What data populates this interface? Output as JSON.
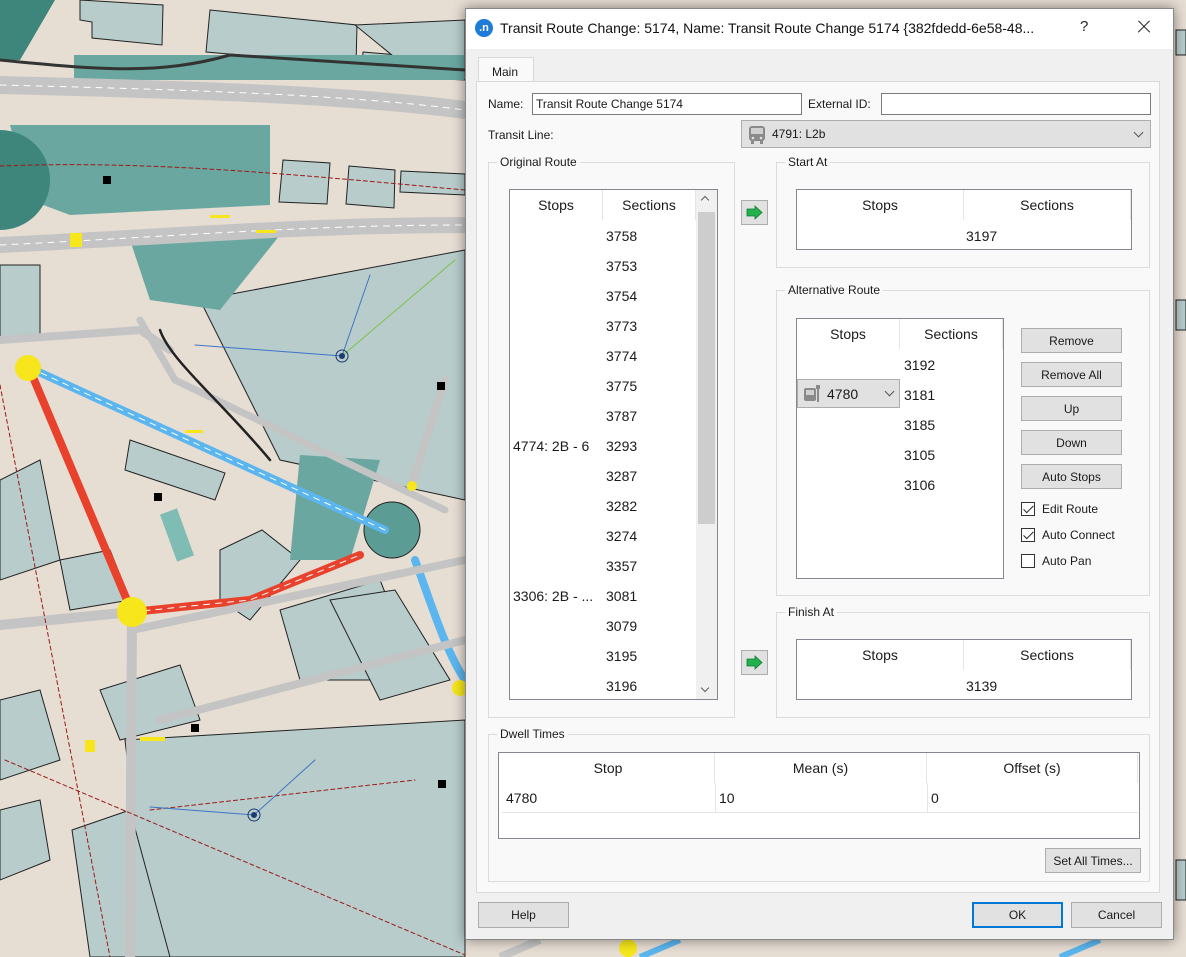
{
  "window": {
    "title": "Transit Route Change: 5174, Name: Transit Route Change 5174  {382fdedd-6e58-48...",
    "help_glyph": "?",
    "app_icon_glyph": ".n"
  },
  "tabs": [
    {
      "label": "Main",
      "active": true
    }
  ],
  "form": {
    "name_label": "Name:",
    "name_value": "Transit Route Change 5174",
    "external_id_label": "External ID:",
    "external_id_value": "",
    "transit_line_label": "Transit Line:",
    "transit_line_value": "4791: L2b",
    "transit_line_icon": "bus-icon"
  },
  "original_route": {
    "title": "Original Route",
    "columns": [
      "Stops",
      "Sections"
    ],
    "rows": [
      {
        "stop": "",
        "section": "3758"
      },
      {
        "stop": "",
        "section": "3753"
      },
      {
        "stop": "",
        "section": "3754"
      },
      {
        "stop": "",
        "section": "3773"
      },
      {
        "stop": "",
        "section": "3774"
      },
      {
        "stop": "",
        "section": "3775"
      },
      {
        "stop": "",
        "section": "3787"
      },
      {
        "stop": "4774: 2B - 6",
        "section": "3293"
      },
      {
        "stop": "",
        "section": "3287"
      },
      {
        "stop": "",
        "section": "3282"
      },
      {
        "stop": "",
        "section": "3274"
      },
      {
        "stop": "",
        "section": "3357"
      },
      {
        "stop": "3306: 2B - ...",
        "section": "3081"
      },
      {
        "stop": "",
        "section": "3079"
      },
      {
        "stop": "",
        "section": "3195"
      },
      {
        "stop": "",
        "section": "3196"
      }
    ]
  },
  "start_at": {
    "title": "Start At",
    "columns": [
      "Stops",
      "Sections"
    ],
    "rows": [
      {
        "stop": "",
        "section": "3197"
      }
    ]
  },
  "alternative_route": {
    "title": "Alternative Route",
    "columns": [
      "Stops",
      "Sections"
    ],
    "rows": [
      {
        "stop": "",
        "section": "3192"
      },
      {
        "stop": "4780",
        "section": "3181"
      },
      {
        "stop": "",
        "section": "3185"
      },
      {
        "stop": "",
        "section": "3105"
      },
      {
        "stop": "",
        "section": "3106"
      }
    ],
    "buttons": [
      "Remove",
      "Remove All",
      "Up",
      "Down",
      "Auto Stops"
    ],
    "checkboxes": [
      {
        "label": "Edit Route",
        "checked": true
      },
      {
        "label": "Auto Connect",
        "checked": true
      },
      {
        "label": "Auto Pan",
        "checked": false
      }
    ]
  },
  "finish_at": {
    "title": "Finish At",
    "columns": [
      "Stops",
      "Sections"
    ],
    "rows": [
      {
        "stop": "",
        "section": "3139"
      }
    ]
  },
  "dwell_times": {
    "title": "Dwell Times",
    "columns": [
      "Stop",
      "Mean (s)",
      "Offset (s)"
    ],
    "rows": [
      {
        "stop": "4780",
        "mean": "10",
        "offset": "0"
      }
    ],
    "set_all_label": "Set All Times..."
  },
  "footer": {
    "help_label": "Help",
    "ok_label": "OK",
    "cancel_label": "Cancel"
  },
  "colors": {
    "accent": "#0078d7",
    "arrow_green": "#22b14c",
    "map_ground": "#e6ddd3",
    "map_building": "#b7cccb",
    "map_park": "#6aa7a0",
    "route_red": "#e8412c",
    "route_blue": "#5bb5ee",
    "node_yellow": "#f6e61b"
  }
}
